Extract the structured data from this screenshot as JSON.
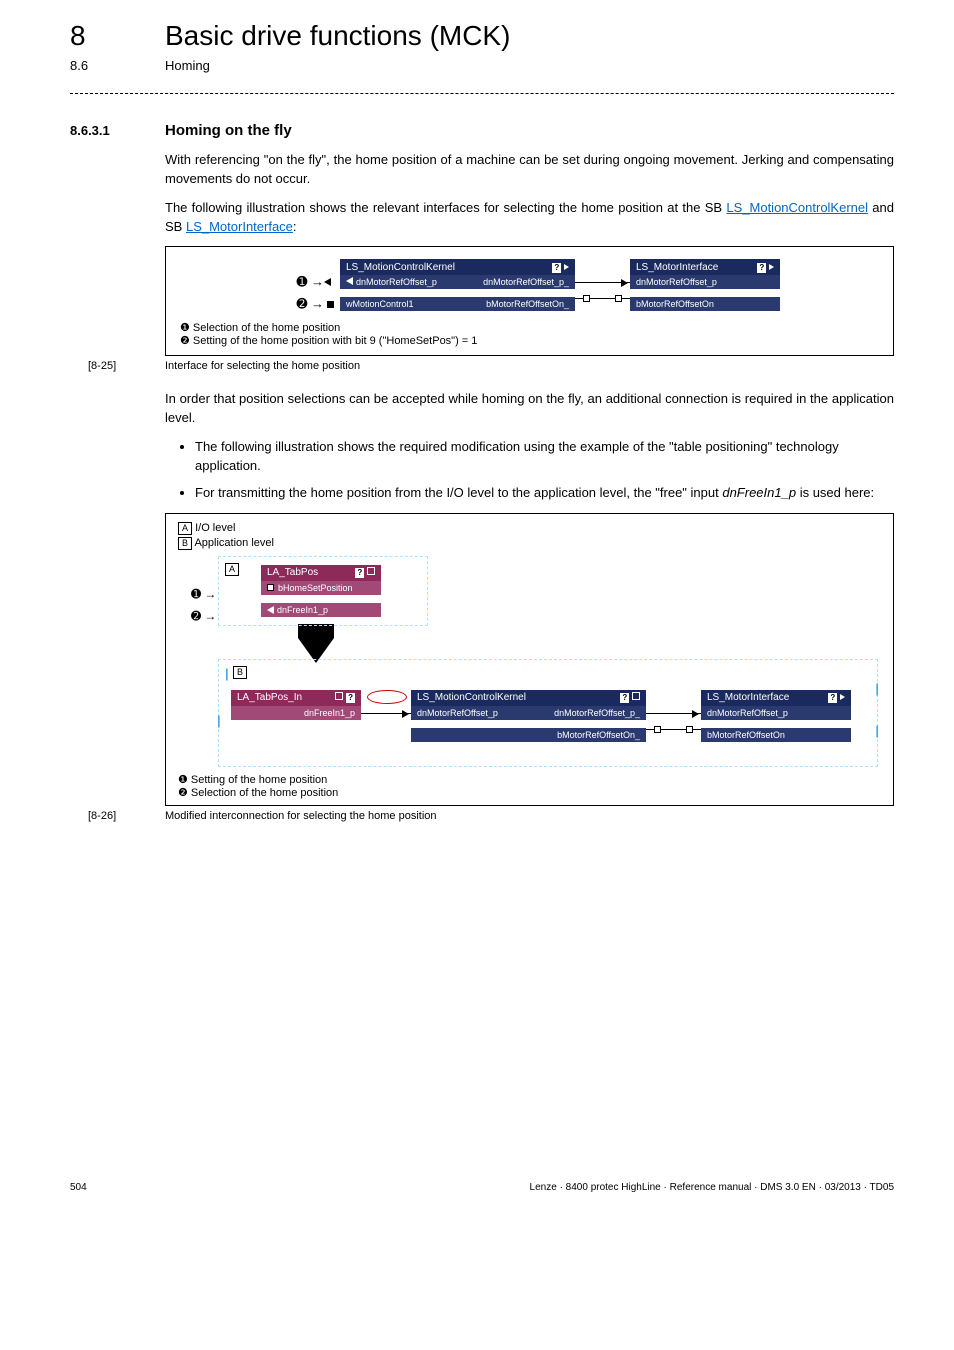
{
  "header": {
    "chapter_num": "8",
    "chapter_title": "Basic drive functions (MCK)",
    "sub_num": "8.6",
    "sub_title": "Homing"
  },
  "section": {
    "num": "8.6.3.1",
    "title": "Homing on the fly"
  },
  "para1": "With referencing \"on the fly\", the home position of a machine can be set during ongoing movement. Jerking and compensating movements do not occur.",
  "para2_pre": "The following illustration shows the relevant interfaces for selecting the home position at the SB ",
  "para2_link1": "LS_MotionControlKernel",
  "para2_mid": " and SB ",
  "para2_link2": "LS_MotorInterface",
  "para2_post": ":",
  "fig1": {
    "block1_title": "LS_MotionControlKernel",
    "block2_title": "LS_MotorInterface",
    "p1_left": "dnMotorRefOffset_p",
    "p1_right": "dnMotorRefOffset_p_",
    "p2_left": "wMotionControl1",
    "p2_right": "bMotorRefOffsetOn_",
    "b2_p1": "dnMotorRefOffset_p",
    "b2_p2": "bMotorRefOffsetOn",
    "note1": "❶ Selection of the home position",
    "note2": "❷ Setting of the home position with bit 9 (\"HomeSetPos\") = 1",
    "caption_tag": "[8-25]",
    "caption_text": "Interface for selecting the home position"
  },
  "para3": "In order that position selections can be accepted while homing on the fly, an additional connection is required in the application level.",
  "bullets": {
    "b1": "The following illustration shows the required modification using the example of the \"table positioning\" technology application.",
    "b2_pre": "For transmitting the home position from the I/O level to the application level, the \"free\" input ",
    "b2_italic": "dnFreeIn1_p",
    "b2_post": " is used here:"
  },
  "fig2": {
    "level_a_label": "I/O level",
    "level_b_label": "Application level",
    "A": "A",
    "B": "B",
    "tabpos_title": "LA_TabPos",
    "tabpos_p1": "bHomeSetPosition",
    "tabpos_p2": "dnFreeIn1_p",
    "tabpos_in_title": "LA_TabPos_In",
    "tabpos_in_p1": "dnFreeIn1_p",
    "mck_title": "LS_MotionControlKernel",
    "mck_p1l": "dnMotorRefOffset_p",
    "mck_p1r": "dnMotorRefOffset_p_",
    "mck_p2r": "bMotorRefOffsetOn_",
    "mi_title": "LS_MotorInterface",
    "mi_p1": "dnMotorRefOffset_p",
    "mi_p2": "bMotorRefOffsetOn",
    "note1": "❶ Setting of the home position",
    "note2": "❷ Selection of the home position",
    "caption_tag": "[8-26]",
    "caption_text": "Modified interconnection for selecting the home position"
  },
  "footer": {
    "page": "504",
    "info": "Lenze · 8400 protec HighLine · Reference manual · DMS 3.0 EN · 03/2013 · TD05"
  }
}
